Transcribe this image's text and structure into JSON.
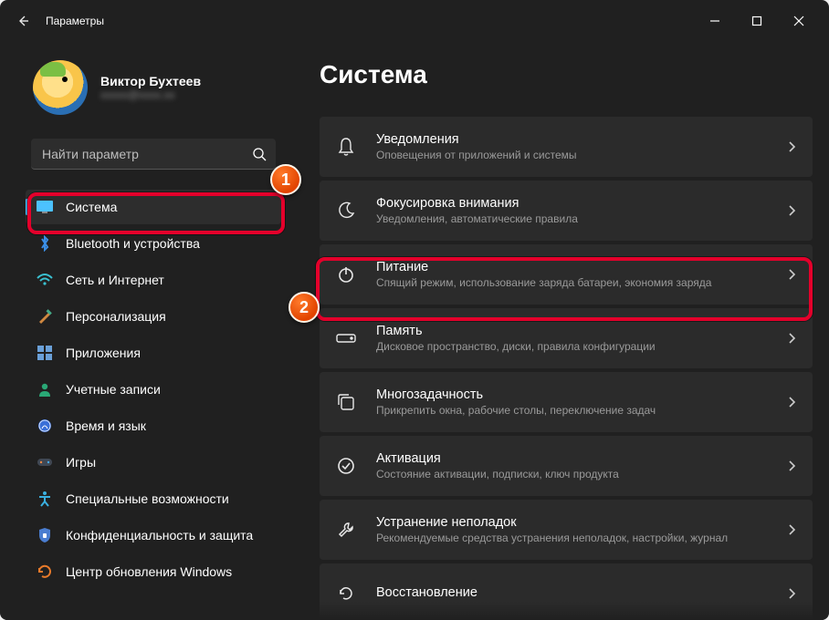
{
  "window": {
    "title": "Параметры"
  },
  "profile": {
    "name": "Виктор Бухтеев",
    "email": "xxxxx@xxxx.xx"
  },
  "search": {
    "placeholder": "Найти параметр"
  },
  "sidebar": {
    "items": [
      {
        "icon": "system",
        "label": "Система"
      },
      {
        "icon": "bluetooth",
        "label": "Bluetooth и устройства"
      },
      {
        "icon": "wifi",
        "label": "Сеть и Интернет"
      },
      {
        "icon": "brush",
        "label": "Персонализация"
      },
      {
        "icon": "apps",
        "label": "Приложения"
      },
      {
        "icon": "user",
        "label": "Учетные записи"
      },
      {
        "icon": "time",
        "label": "Время и язык"
      },
      {
        "icon": "game",
        "label": "Игры"
      },
      {
        "icon": "access",
        "label": "Специальные возможности"
      },
      {
        "icon": "privacy",
        "label": "Конфиденциальность и защита"
      },
      {
        "icon": "update",
        "label": "Центр обновления Windows"
      }
    ]
  },
  "main": {
    "title": "Система",
    "cards": [
      {
        "icon": "bell",
        "title": "Уведомления",
        "sub": "Оповещения от приложений и системы"
      },
      {
        "icon": "moon",
        "title": "Фокусировка внимания",
        "sub": "Уведомления, автоматические правила"
      },
      {
        "icon": "power",
        "title": "Питание",
        "sub": "Спящий режим, использование заряда батареи, экономия заряда"
      },
      {
        "icon": "storage",
        "title": "Память",
        "sub": "Дисковое пространство, диски, правила конфигурации"
      },
      {
        "icon": "multi",
        "title": "Многозадачность",
        "sub": "Прикрепить окна, рабочие столы, переключение задач"
      },
      {
        "icon": "check",
        "title": "Активация",
        "sub": "Состояние активации, подписки, ключ продукта"
      },
      {
        "icon": "wrench",
        "title": "Устранение неполадок",
        "sub": "Рекомендуемые средства устранения неполадок, настройки, журнал"
      },
      {
        "icon": "recover",
        "title": "Восстановление",
        "sub": ""
      }
    ]
  },
  "annotations": {
    "badge1": "1",
    "badge2": "2"
  }
}
